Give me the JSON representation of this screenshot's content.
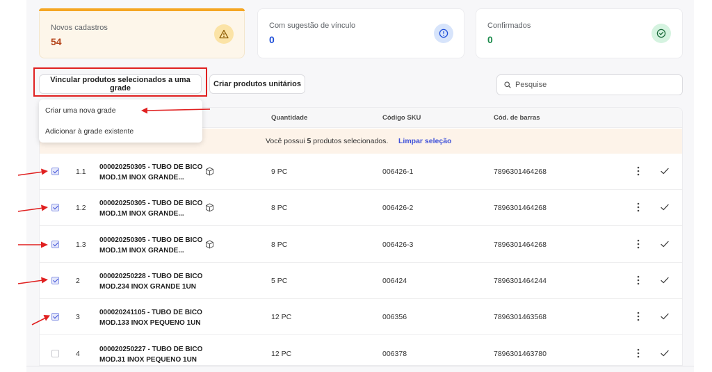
{
  "cards": [
    {
      "title": "Novos cadastros",
      "value": "54",
      "icon": "warning-icon"
    },
    {
      "title": "Com sugestão de vínculo",
      "value": "0",
      "icon": "info-icon"
    },
    {
      "title": "Confirmados",
      "value": "0",
      "icon": "check-circle-icon"
    }
  ],
  "colors": {
    "warn": "#b5451b",
    "info": "#1f4fd8",
    "success": "#1a8a4a",
    "accent": "#3f51d9",
    "highlight": "#e02020"
  },
  "toolbar": {
    "link_button": "Vincular produtos selecionados a uma grade",
    "create_button": "Criar produtos unitários"
  },
  "search": {
    "placeholder": "Pesquise"
  },
  "dropdown": {
    "items": [
      "Criar uma nova grade",
      "Adicionar à grade existente"
    ]
  },
  "table": {
    "headers": {
      "quantity": "Quantidade",
      "sku": "Código SKU",
      "barcode": "Cód. de barras"
    },
    "selection": {
      "prefix": "Você possui ",
      "count": "5",
      "suffix": " produtos selecionados.",
      "clear": "Limpar seleção"
    },
    "rows": [
      {
        "index": "1.1",
        "name": "000020250305 - TUBO DE BICO MOD.1M INOX GRANDE...",
        "has_cube": true,
        "qty": "9 PC",
        "sku": "006426-1",
        "barcode": "7896301464268",
        "checked": true
      },
      {
        "index": "1.2",
        "name": "000020250305 - TUBO DE BICO MOD.1M INOX GRANDE...",
        "has_cube": true,
        "qty": "8 PC",
        "sku": "006426-2",
        "barcode": "7896301464268",
        "checked": true
      },
      {
        "index": "1.3",
        "name": "000020250305 - TUBO DE BICO MOD.1M INOX GRANDE...",
        "has_cube": true,
        "qty": "8 PC",
        "sku": "006426-3",
        "barcode": "7896301464268",
        "checked": true
      },
      {
        "index": "2",
        "name": "000020250228 - TUBO DE BICO MOD.234 INOX GRANDE 1UN",
        "has_cube": false,
        "qty": "5 PC",
        "sku": "006424",
        "barcode": "7896301464244",
        "checked": true
      },
      {
        "index": "3",
        "name": "000020241105 - TUBO DE BICO MOD.133 INOX PEQUENO 1UN",
        "has_cube": false,
        "qty": "12 PC",
        "sku": "006356",
        "barcode": "7896301463568",
        "checked": true
      },
      {
        "index": "4",
        "name": "000020250227 - TUBO DE BICO MOD.31 INOX PEQUENO 1UN",
        "has_cube": false,
        "qty": "12 PC",
        "sku": "006378",
        "barcode": "7896301463780",
        "checked": false
      }
    ]
  }
}
